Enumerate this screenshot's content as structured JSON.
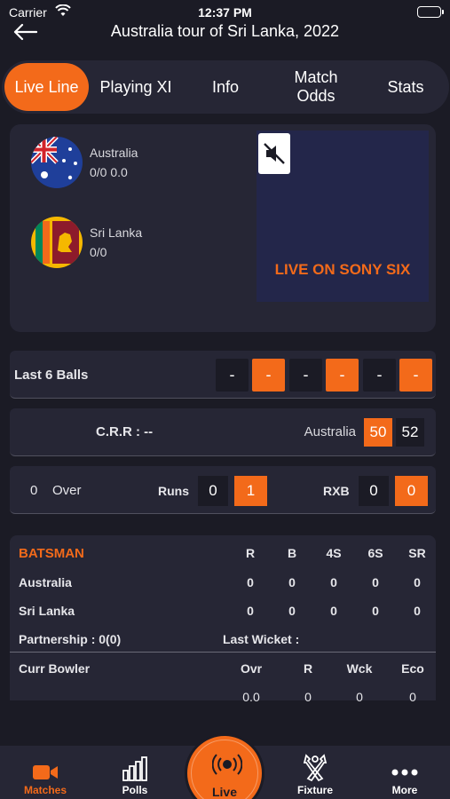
{
  "status": {
    "carrier": "Carrier",
    "time": "12:37 PM"
  },
  "header": {
    "title": "Australia tour of Sri Lanka, 2022"
  },
  "tabs": [
    "Live Line",
    "Playing XI",
    "Info",
    "Match Odds",
    "Stats"
  ],
  "teams": [
    {
      "name": "Australia",
      "score": "0/0 0.0"
    },
    {
      "name": "Sri Lanka",
      "score": "0/0"
    }
  ],
  "broadcast": {
    "text": "LIVE ON SONY SIX"
  },
  "last_balls": {
    "label": "Last 6 Balls",
    "balls": [
      "-",
      "-",
      "-",
      "-",
      "-",
      "-"
    ]
  },
  "crr": {
    "label": "C.R.R : --",
    "team": "Australia",
    "odds": [
      "50",
      "52"
    ]
  },
  "over": {
    "value": "0",
    "label": "Over",
    "runs_label": "Runs",
    "runs": [
      "0",
      "1"
    ],
    "rxb_label": "RXB",
    "rxb": [
      "0",
      "0"
    ]
  },
  "batsman": {
    "title": "BATSMAN",
    "columns": [
      "R",
      "B",
      "4S",
      "6S",
      "SR"
    ],
    "rows": [
      {
        "name": "Australia",
        "values": [
          "0",
          "0",
          "0",
          "0",
          "0"
        ]
      },
      {
        "name": "Sri Lanka",
        "values": [
          "0",
          "0",
          "0",
          "0",
          "0"
        ]
      }
    ],
    "partnership": "Partnership : 0(0)",
    "last_wicket": "Last Wicket :"
  },
  "bowler": {
    "title": "Curr Bowler",
    "columns": [
      "Ovr",
      "R",
      "Wck",
      "Eco"
    ],
    "values": [
      "0.0",
      "0",
      "0",
      "0"
    ]
  },
  "nav": {
    "items": [
      "Matches",
      "Polls",
      "Live",
      "Fixture",
      "More"
    ],
    "active": "Matches"
  },
  "colors": {
    "accent": "#f36a1a",
    "background": "#1b1b25",
    "card": "#262635"
  }
}
